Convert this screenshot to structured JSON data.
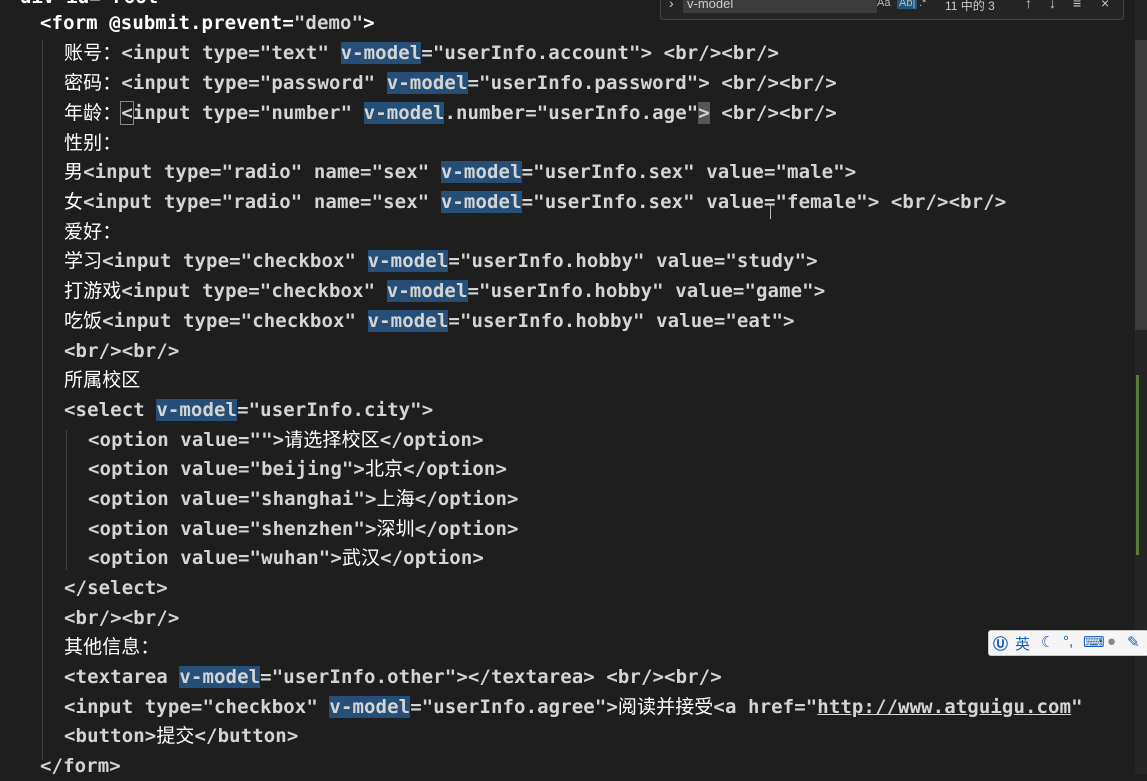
{
  "find_widget": {
    "query": "v-model",
    "match_case": "Aa",
    "whole_word": "Ab|",
    "regex": ".*",
    "result_count": "11 中的 3",
    "prev": "↑",
    "next": "↓",
    "in_selection": "≡",
    "close": "×"
  },
  "code": {
    "top_partial": "div id=\"root\"",
    "l1_form_open": "<form",
    "l1_attr": "@submit.prevent=",
    "l1_val": "\"demo\"",
    "l1_close": ">",
    "account_label": "账号：",
    "password_label": "密码：",
    "age_label": "年龄：",
    "gender_label": "性别：",
    "male_label": "男",
    "female_label": "女",
    "hobby_label": "爱好：",
    "study_label": "学习",
    "game_label": "打游戏",
    "eat_label": "吃饭",
    "campus_label": "所属校区",
    "opt_placeholder": "请选择校区",
    "opt_beijing": "北京",
    "opt_shanghai": "上海",
    "opt_shenzhen": "深圳",
    "opt_wuhan": "武汉",
    "other_label": "其他信息：",
    "agree_text": "阅读并接受",
    "link_url": "http://www.atguigu.com",
    "submit_label": "提交",
    "form_close": "</form>"
  },
  "ime_toolbar": {
    "mode": "英",
    "icons": [
      "moon-icon",
      "punctuation-icon",
      "keyboard-icon",
      "user-icon",
      "wrench-icon"
    ]
  },
  "colors": {
    "background": "#1e1e1e",
    "highlight": "#264f78"
  }
}
